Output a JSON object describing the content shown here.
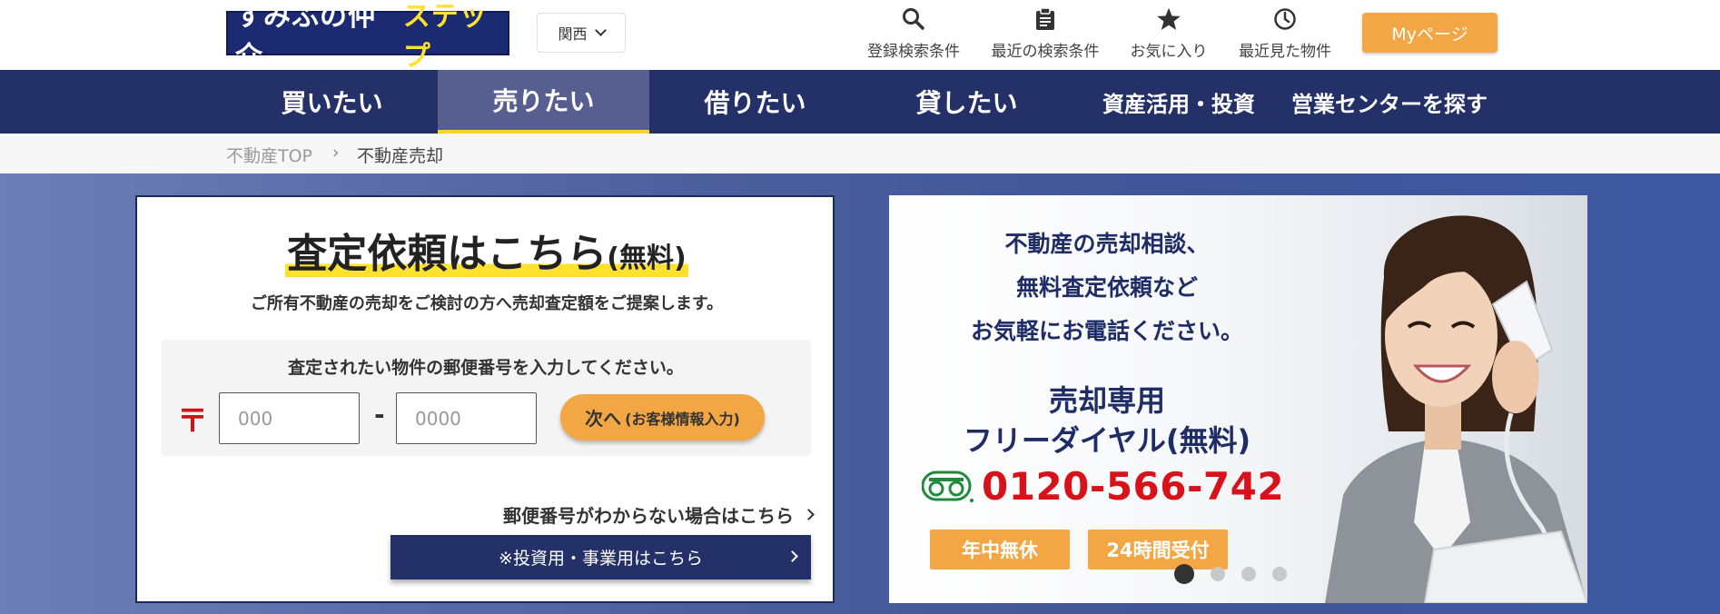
{
  "header": {
    "logo_part1": "すみふの仲介",
    "logo_part2": "ステップ",
    "region": "関西",
    "nav": [
      {
        "label": "登録検索条件",
        "icon": "search-icon"
      },
      {
        "label": "最近の検索条件",
        "icon": "clipboard-icon"
      },
      {
        "label": "お気に入り",
        "icon": "star-icon"
      },
      {
        "label": "最近見た物件",
        "icon": "clock-icon"
      }
    ],
    "mypage": "Myページ"
  },
  "mainnav": {
    "items": [
      "買いたい",
      "売りたい",
      "借りたい",
      "貸したい",
      "資産活用・投資",
      "営業センターを探す"
    ],
    "active_index": 1
  },
  "breadcrumb": {
    "home": "不動産TOP",
    "separator": "›",
    "current": "不動産売却"
  },
  "form": {
    "title": "査定依頼はこちら",
    "title_free": "(無料)",
    "subtitle": "ご所有不動産の売却をご検討の方へ売却査定額をご提案します。",
    "zip_prompt": "査定されたい物件の郵便番号を入力してください。",
    "postal_mark": "〒",
    "zip1_placeholder": "000",
    "zip2_placeholder": "0000",
    "zip_dash": "-",
    "next_label": "次へ",
    "next_sub": "(お客様情報入力)",
    "unknown_zip": "郵便番号がわからない場合はこちら",
    "invest_label": "※投資用・事業用はこちら"
  },
  "banner": {
    "message": [
      "不動産の売却相談、",
      "無料査定依頼など",
      "お気軽にお電話ください。"
    ],
    "heading1": "売却専用",
    "heading2": "フリーダイヤル(無料)",
    "phone": "0120-566-742",
    "tag1": "年中無休",
    "tag2": "24時間受付",
    "slides": 4,
    "active_slide": 0
  },
  "colors": {
    "navy": "#243068",
    "orange": "#f3a744",
    "yellow": "#ffe12e",
    "red": "#d8121b"
  }
}
